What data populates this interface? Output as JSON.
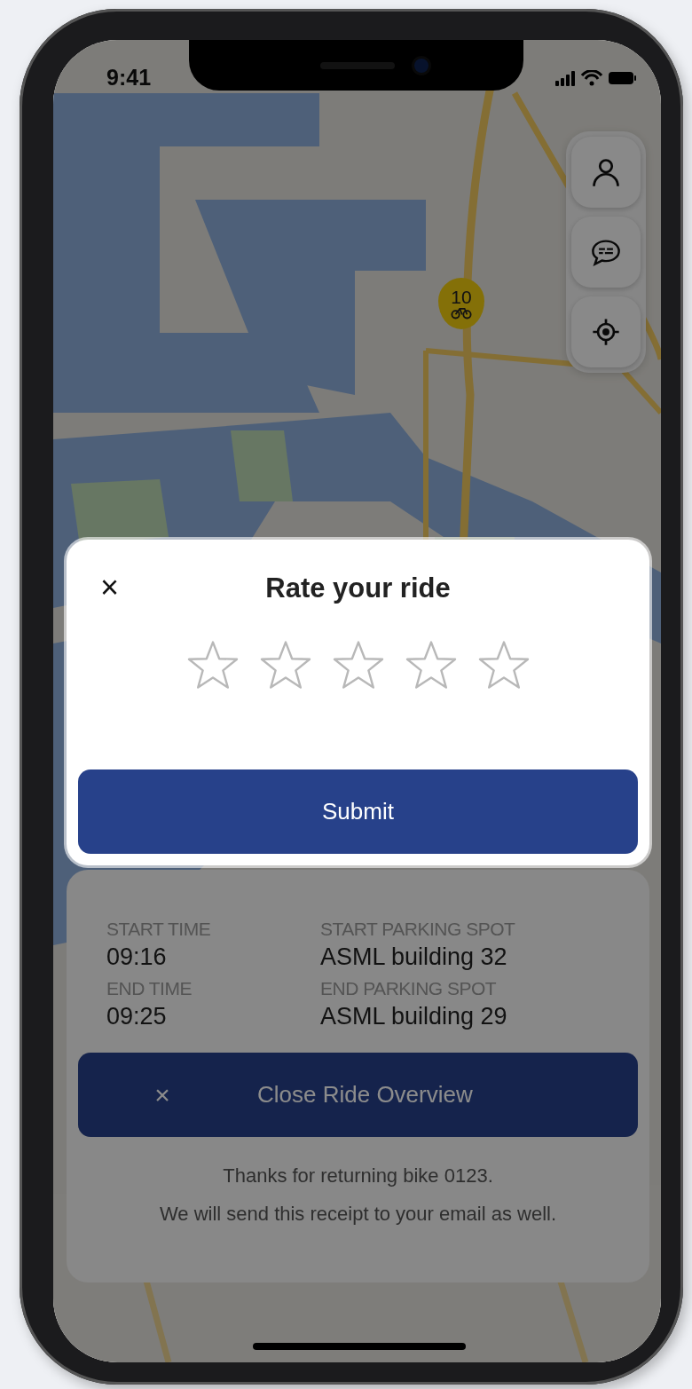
{
  "status_bar": {
    "time": "9:41"
  },
  "map_controls": [
    {
      "kind": "profile"
    },
    {
      "kind": "chat"
    },
    {
      "kind": "locate"
    }
  ],
  "bike_marker": {
    "count": "10"
  },
  "ride_overview": {
    "details": [
      {
        "label": "START TIME",
        "value": "09:16"
      },
      {
        "label": "START PARKING SPOT",
        "value": "ASML building 32"
      },
      {
        "label": "END TIME",
        "value": "09:25"
      },
      {
        "label": "END PARKING SPOT",
        "value": "ASML building 29"
      }
    ],
    "close_button": {
      "icon": "×",
      "label": "Close Ride Overview"
    },
    "note": "Thanks for returning bike 0123.\nWe will send this receipt to your email as well."
  },
  "rating_dialog": {
    "close_icon": "×",
    "title": "Rate your ride",
    "stars": 0,
    "submit_button": "Submit"
  }
}
